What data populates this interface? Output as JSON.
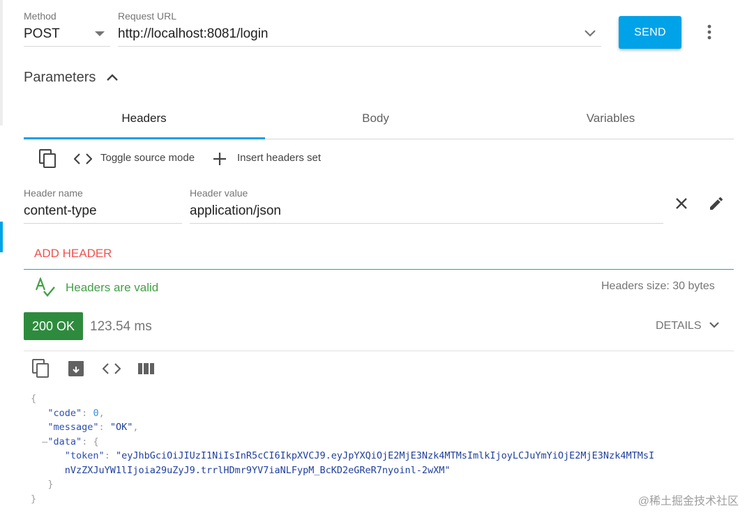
{
  "request": {
    "method_label": "Method",
    "method_value": "POST",
    "url_label": "Request URL",
    "url_value": "http://localhost:8081/login",
    "send_label": "SEND"
  },
  "parameters": {
    "title": "Parameters",
    "tabs": [
      {
        "label": "Headers",
        "active": true
      },
      {
        "label": "Body",
        "active": false
      },
      {
        "label": "Variables",
        "active": false
      }
    ]
  },
  "headers_toolbar": {
    "toggle_source_label": "Toggle source mode",
    "insert_set_label": "Insert headers set"
  },
  "header_row": {
    "name_label": "Header name",
    "name_value": "content-type",
    "value_label": "Header value",
    "value_value": "application/json"
  },
  "add_header_label": "ADD HEADER",
  "validation": {
    "message": "Headers are valid",
    "size_text": "Headers size: 30 bytes"
  },
  "response": {
    "status": "200 OK",
    "time": "123.54 ms",
    "details_label": "DETAILS",
    "json": {
      "code_key": "\"code\"",
      "code_val": "0",
      "message_key": "\"message\"",
      "message_val": "\"OK\"",
      "data_key": "\"data\"",
      "token_key": "\"token\"",
      "token_line1": "\"eyJhbGciOiJIUzI1NiIsInR5cCI6IkpXVCJ9.eyJpYXQiOjE2MjE3Nzk4MTMsImlkIjoyLCJuYmYiOjE2MjE3Nzk4MTMsI",
      "token_line2": "nVzZXJuYW1lIjoia29uZyJ9.trrlHDmr9YV7iaNLFypM_BcKD2eGReR7nyoinl-2wXM\""
    }
  },
  "watermark": "@稀土掘金技术社区",
  "colors": {
    "accent": "#00a2e8",
    "add_header": "#ef5350",
    "valid": "#43a047",
    "status_ok": "#2e8b3e",
    "tab_underline": "#00a2e8"
  },
  "icons": [
    "dropdown-arrow-icon",
    "chevron-down-icon",
    "more-vert-icon",
    "chevron-up-icon",
    "copy-icon",
    "code-icon",
    "add-icon",
    "close-icon",
    "edit-icon",
    "spellcheck-icon",
    "archive-icon",
    "columns-icon"
  ]
}
